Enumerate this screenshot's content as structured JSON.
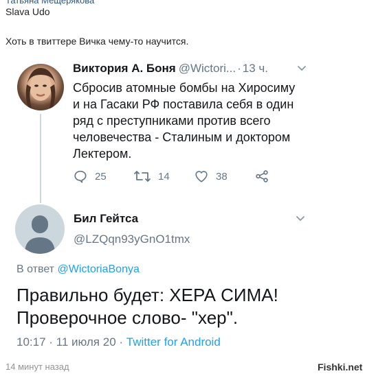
{
  "post": {
    "author": "Татьяна Мещерякова",
    "reply_to_name": "Slava Udo",
    "text": "Хоть в твиттере Вичка чему-то научится.",
    "time": "14 минут назад",
    "watermark": "Fishki.net"
  },
  "tweet1": {
    "name": "Виктория А. Боня",
    "handle": "@Wictori...",
    "separator": "·",
    "time": "13 ч.",
    "text": "Сбросив атомные бомбы на Хиросиму и на Гасаки РФ поставила себя в один ряд с преступниками против всего человечества - Сталиным и доктором Лектером.",
    "replies": "25",
    "retweets": "14",
    "likes": "38"
  },
  "tweet2": {
    "name": "Бил Гейтса",
    "handle": "@LZQqn93yGnO1tmx",
    "reply_prefix": "В ответ",
    "reply_handle": "@WictoriaBonya",
    "text": "Правильно будет: ХЕРА СИМА! Проверочное слово- \"хер\".",
    "timestamp": "10:17 · 11 июля 20 ·",
    "client": "Twitter for Android"
  },
  "colors": {
    "link_blue": "#1da1f2",
    "text_dark": "#14171a",
    "text_gray": "#657786",
    "vk_link": "#2a5885"
  },
  "icons": {
    "reply": "reply-icon",
    "retweet": "retweet-icon",
    "like": "heart-icon",
    "share": "share-icon",
    "menu": "chevron-down-icon"
  }
}
